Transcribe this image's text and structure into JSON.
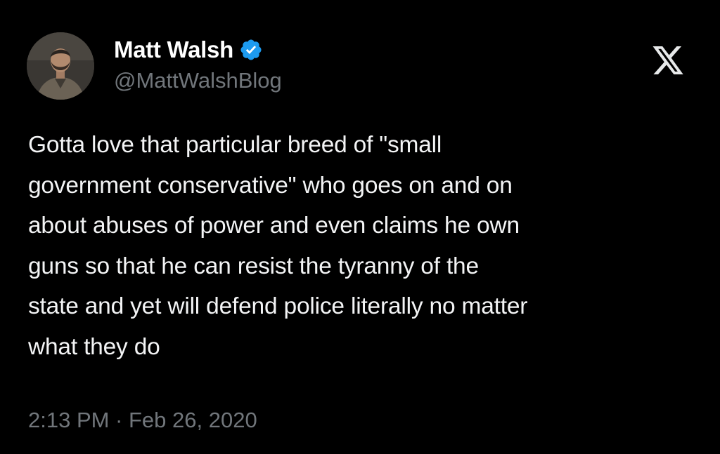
{
  "tweet": {
    "display_name": "Matt Walsh",
    "handle": "@MattWalshBlog",
    "verified": true,
    "text": "Gotta love that particular breed of \"small\ngovernment conservative\" who goes on and on\nabout abuses of power and even claims he own\nguns so that he can resist the tyranny of the\nstate and yet will defend police literally no matter\nwhat they do",
    "timestamp": "2:13 PM · Feb 26, 2020"
  },
  "icons": {
    "verified": "verified-badge-icon",
    "platform": "x-logo-icon",
    "avatar": "avatar"
  },
  "colors": {
    "background": "#000000",
    "text_primary": "#e7e9ea",
    "text_secondary": "#71767b",
    "verified_blue": "#1d9bf0"
  }
}
